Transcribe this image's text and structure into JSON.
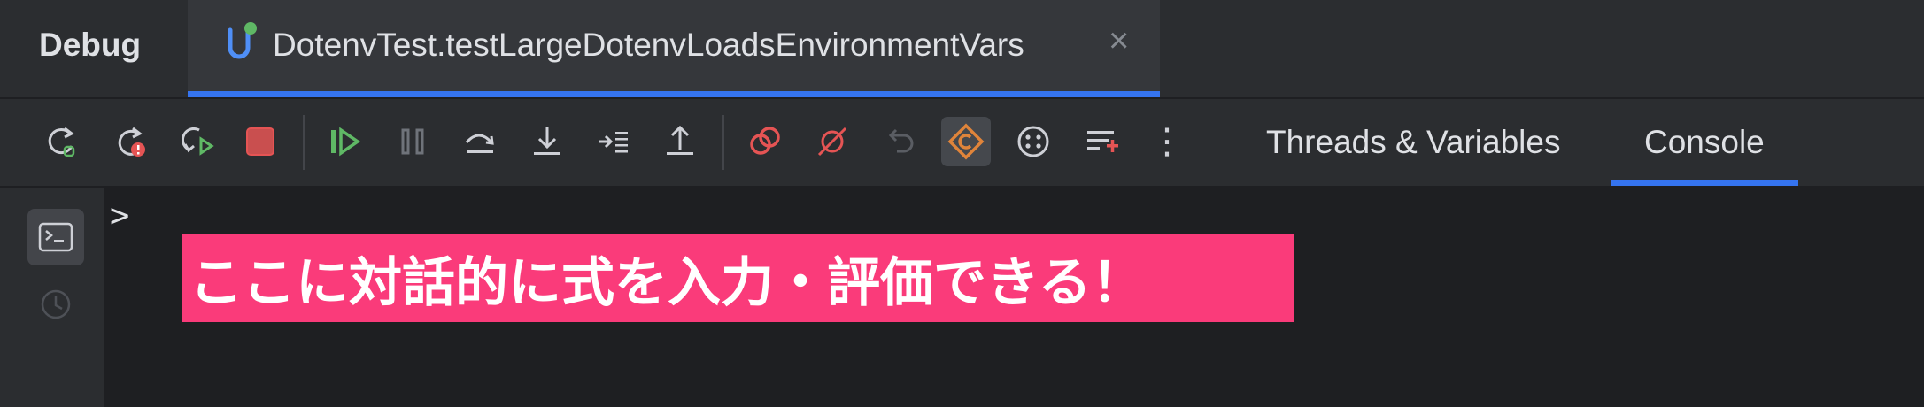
{
  "tabbar": {
    "panel_label": "Debug",
    "run_tab": {
      "title": "DotenvTest.testLargeDotenvLoadsEnvironmentVars",
      "close": "×"
    }
  },
  "toolbar": {
    "buttons": [
      "rerun-icon",
      "rerun-failed-icon",
      "restart-icon",
      "stop-icon",
      "resume-icon",
      "pause-icon",
      "step-over-icon",
      "step-into-icon",
      "run-to-cursor-icon",
      "step-out-icon",
      "view-breakpoints-icon",
      "mute-breakpoints-icon",
      "reset-frame-icon",
      "coroutine-icon",
      "evaluate-icon",
      "add-watch-icon",
      "more-icon"
    ],
    "more_label": "⋮",
    "tabs": [
      "Threads & Variables",
      "Console"
    ],
    "selected_tab": "Console"
  },
  "console": {
    "prompt": ">"
  },
  "banner": {
    "text": "ここに対話的に式を入力・評価できる！"
  },
  "colors": {
    "accent": "#3574f0",
    "banner": "#fa3b7a",
    "stop_red": "#e55454",
    "run_green": "#5fb865"
  }
}
